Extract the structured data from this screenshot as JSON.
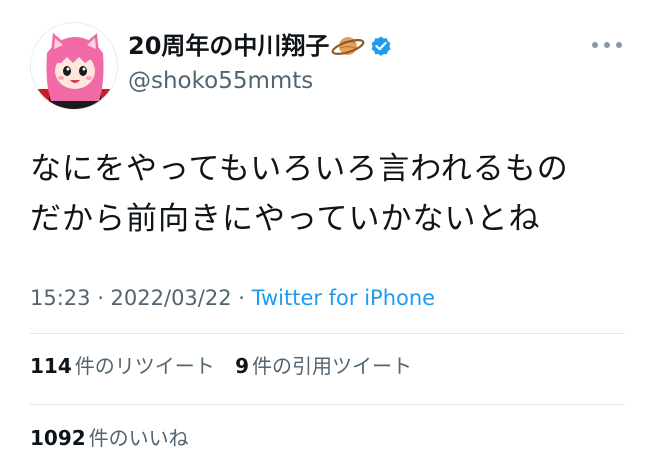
{
  "user": {
    "display_name": "20周年の中川翔子",
    "handle": "@shoko55mmts",
    "name_emoji": "saturn-ringed-planet-icon",
    "verified_icon": "verified-badge-icon",
    "avatar": "pink-haired-cat-ear-character-avatar"
  },
  "tweet": {
    "lines": [
      "なにをやってもいろいろ言われるもの",
      "だから前向きにやっていかないとね"
    ],
    "time": "15:23 · 2022/03/22 · ",
    "source": "Twitter for iPhone"
  },
  "stats": {
    "retweets_count": "114",
    "retweets_label": "件のリツイート",
    "quotes_count": "9",
    "quotes_label": "件の引用ツイート",
    "likes_count": "1092",
    "likes_label": "件のいいね"
  },
  "colors": {
    "link": "#1d9bf0",
    "secondary_text": "#536471",
    "verified": "#1d9bf0",
    "divider": "#e1e8ed"
  }
}
